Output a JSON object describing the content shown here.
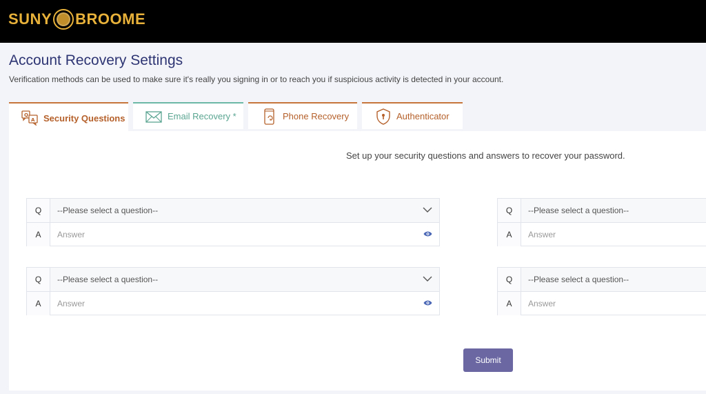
{
  "brand": {
    "left": "SUNY",
    "right": "BROOME"
  },
  "page": {
    "title": "Account Recovery Settings",
    "subtitle": "Verification methods can be used to make sure it's really you signing in or to reach you if suspicious activity is detected in your account."
  },
  "tabs": [
    {
      "label": "Security Questions",
      "icon": "qa-chat-icon",
      "active": true
    },
    {
      "label": "Email Recovery *",
      "icon": "envelope-icon",
      "active": false
    },
    {
      "label": "Phone Recovery",
      "icon": "phone-icon",
      "active": false
    },
    {
      "label": "Authenticator",
      "icon": "shield-icon",
      "active": false
    }
  ],
  "panel": {
    "instructions": "Set up your security questions and answers to recover your password.",
    "q_label": "Q",
    "a_label": "A",
    "pairs": [
      {
        "question_placeholder": "--Please select a question--",
        "answer_placeholder": "Answer"
      },
      {
        "question_placeholder": "--Please select a question--",
        "answer_placeholder": "Answer"
      },
      {
        "question_placeholder": "--Please select a question--",
        "answer_placeholder": "Answer"
      },
      {
        "question_placeholder": "--Please select a question--",
        "answer_placeholder": "Answer"
      }
    ],
    "submit_label": "Submit"
  },
  "colors": {
    "header_bg": "#000000",
    "brand_gold": "#e8b23a",
    "title_navy": "#2e3573",
    "tab_orange": "#c7743a",
    "tab_teal": "#6cb8a6",
    "submit_purple": "#6a67a3"
  }
}
